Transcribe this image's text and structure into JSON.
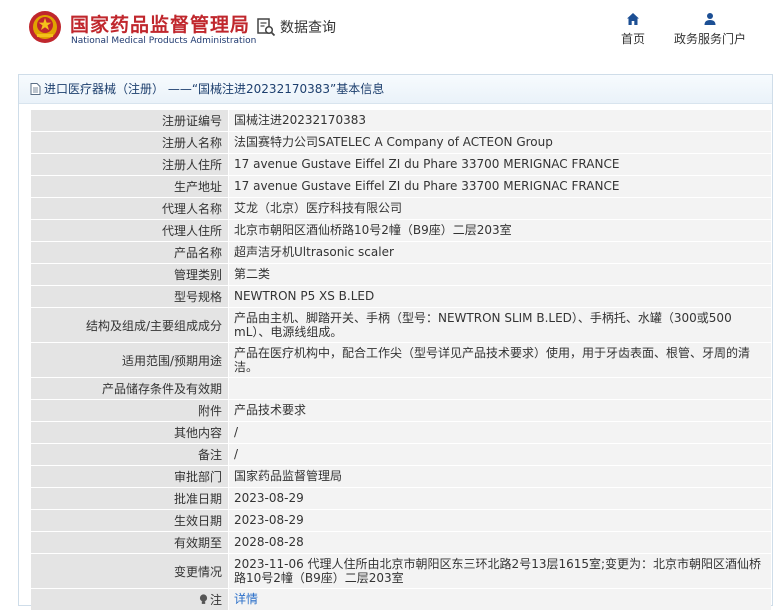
{
  "header": {
    "brand_cn": "国家药品监督管理局",
    "brand_en": "National Medical Products Administration",
    "query_label": "数据查询",
    "nav": [
      {
        "label": "首页",
        "icon": "home-icon"
      },
      {
        "label": "政务服务门户",
        "icon": "user-icon"
      }
    ]
  },
  "panel": {
    "title": "进口医疗器械（注册） ——“国械注进20232170383”基本信息"
  },
  "fields": [
    {
      "label": "注册证编号",
      "value": "国械注进20232170383"
    },
    {
      "label": "注册人名称",
      "value": "法国赛特力公司SATELEC A Company of ACTEON Group"
    },
    {
      "label": "注册人住所",
      "value": "17 avenue Gustave Eiffel ZI du Phare 33700 MERIGNAC FRANCE"
    },
    {
      "label": "生产地址",
      "value": "17 avenue Gustave Eiffel ZI du Phare 33700 MERIGNAC FRANCE"
    },
    {
      "label": "代理人名称",
      "value": "艾龙（北京）医疗科技有限公司"
    },
    {
      "label": "代理人住所",
      "value": "北京市朝阳区酒仙桥路10号2幢（B9座）二层203室"
    },
    {
      "label": "产品名称",
      "value": "超声洁牙机Ultrasonic scaler"
    },
    {
      "label": "管理类别",
      "value": "第二类"
    },
    {
      "label": "型号规格",
      "value": "NEWTRON P5 XS B.LED"
    },
    {
      "label": "结构及组成/主要组成成分",
      "value": "产品由主机、脚踏开关、手柄（型号：NEWTRON SLIM B.LED）、手柄托、水罐（300或500 mL）、电源线组成。"
    },
    {
      "label": "适用范围/预期用途",
      "value": "产品在医疗机构中，配合工作尖（型号详见产品技术要求）使用，用于牙齿表面、根管、牙周的清洁。"
    },
    {
      "label": "产品储存条件及有效期",
      "value": ""
    },
    {
      "label": "附件",
      "value": "产品技术要求"
    },
    {
      "label": "其他内容",
      "value": "/"
    },
    {
      "label": "备注",
      "value": "/"
    },
    {
      "label": "审批部门",
      "value": "国家药品监督管理局"
    },
    {
      "label": "批准日期",
      "value": "2023-08-29"
    },
    {
      "label": "生效日期",
      "value": "2023-08-29"
    },
    {
      "label": "有效期至",
      "value": "2028-08-28"
    },
    {
      "label": "变更情况",
      "value": "2023-11-06 代理人住所由北京市朝阳区东三环北路2号13层1615室;变更为：北京市朝阳区酒仙桥路10号2幢（B9座）二层203室"
    }
  ],
  "note_row": {
    "label": "注",
    "link": "详情",
    "icon": "lightbulb-icon"
  }
}
